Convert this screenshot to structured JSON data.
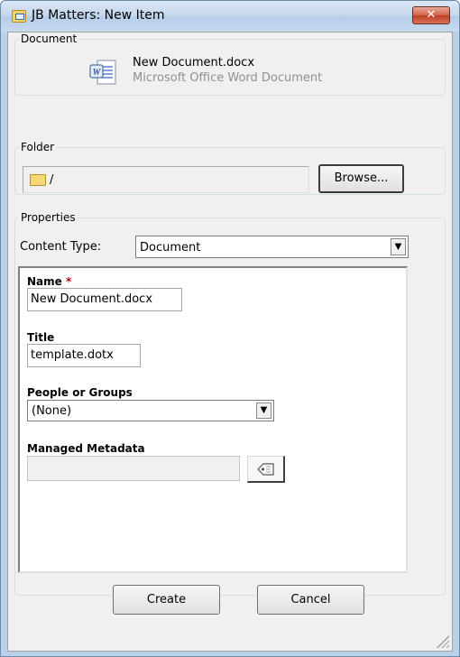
{
  "window": {
    "title": "JB Matters: New Item",
    "close_glyph": "✕"
  },
  "document_section": {
    "legend": "Document",
    "file_name": "New Document.docx",
    "file_type": "Microsoft Office Word Document",
    "icon": "word-document-icon"
  },
  "folder_section": {
    "legend": "Folder",
    "path": "/",
    "browse_label": "Browse..."
  },
  "properties_section": {
    "legend": "Properties",
    "content_type_label": "Content Type:",
    "content_type_value": "Document",
    "fields": {
      "name": {
        "label": "Name",
        "required_marker": "*",
        "value": "New Document.docx"
      },
      "title": {
        "label": "Title",
        "value": "template.dotx"
      },
      "people": {
        "label": "People or Groups",
        "value": "(None)"
      },
      "metadata": {
        "label": "Managed Metadata",
        "value": "",
        "icon": "tags-icon"
      }
    }
  },
  "footer": {
    "create_label": "Create",
    "cancel_label": "Cancel"
  },
  "colors": {
    "title_bar": "#c5d9ef",
    "close_button": "#c03e25",
    "required": "#c00000",
    "dialog_bg": "#f0f0f0"
  }
}
